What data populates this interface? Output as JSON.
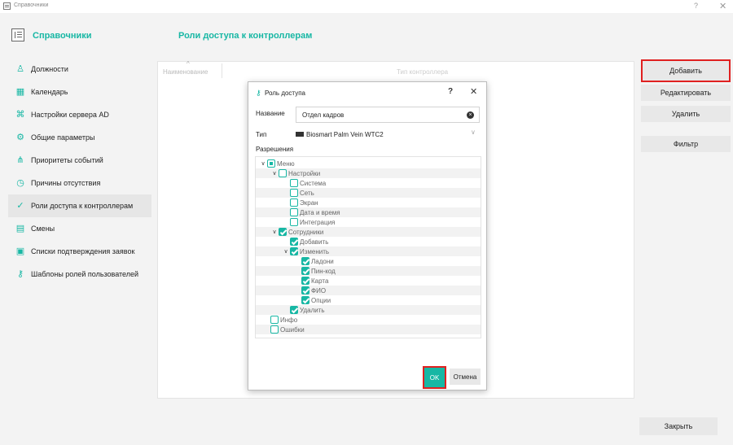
{
  "window": {
    "title": "Справочники",
    "help": "?",
    "close": "✕"
  },
  "header": {
    "title": "Справочники",
    "page_title": "Роли доступа к контроллерам"
  },
  "sidebar": {
    "items": [
      {
        "label": "Должности",
        "icon": "person-icon"
      },
      {
        "label": "Календарь",
        "icon": "calendar-icon"
      },
      {
        "label": "Настройки сервера AD",
        "icon": "network-icon"
      },
      {
        "label": "Общие параметры",
        "icon": "gear-icon"
      },
      {
        "label": "Приоритеты событий",
        "icon": "hierarchy-icon"
      },
      {
        "label": "Причины отсутствия",
        "icon": "clock-icon"
      },
      {
        "label": "Роли доступа к контроллерам",
        "icon": "shield-check-icon",
        "active": true
      },
      {
        "label": "Смены",
        "icon": "schedule-icon"
      },
      {
        "label": "Списки подтверждения заявок",
        "icon": "clipboard-icon"
      },
      {
        "label": "Шаблоны ролей пользователей",
        "icon": "key-icon"
      }
    ]
  },
  "table": {
    "columns": [
      "Наименование",
      "Тип контроллера"
    ]
  },
  "actions": {
    "add": "Добавить",
    "edit": "Редактировать",
    "delete": "Удалить",
    "filter": "Фильтр",
    "close": "Закрыть"
  },
  "dialog": {
    "title": "Роль доступа",
    "help": "?",
    "close": "✕",
    "name_label": "Название",
    "name_value": "Отдел кадров",
    "type_label": "Тип",
    "type_value": "Biosmart Palm Vein WTC2",
    "permissions_label": "Разрешения",
    "tree": [
      {
        "label": "Меню",
        "level": 0,
        "arrow": true,
        "state": "partial"
      },
      {
        "label": "Настройки",
        "level": 1,
        "arrow": true,
        "state": "unchecked"
      },
      {
        "label": "Система",
        "level": 2,
        "arrow": false,
        "state": "unchecked"
      },
      {
        "label": "Сеть",
        "level": 2,
        "arrow": false,
        "state": "unchecked"
      },
      {
        "label": "Экран",
        "level": 2,
        "arrow": false,
        "state": "unchecked"
      },
      {
        "label": "Дата и время",
        "level": 2,
        "arrow": false,
        "state": "unchecked"
      },
      {
        "label": "Интеграция",
        "level": 2,
        "arrow": false,
        "state": "unchecked"
      },
      {
        "label": "Сотрудники",
        "level": 1,
        "arrow": true,
        "state": "checked"
      },
      {
        "label": "Добавить",
        "level": 2,
        "arrow": false,
        "state": "checked"
      },
      {
        "label": "Изменить",
        "level": 2,
        "arrow": true,
        "state": "checked"
      },
      {
        "label": "Ладони",
        "level": 3,
        "arrow": false,
        "state": "checked"
      },
      {
        "label": "Пин-код",
        "level": 3,
        "arrow": false,
        "state": "checked"
      },
      {
        "label": "Карта",
        "level": 3,
        "arrow": false,
        "state": "checked"
      },
      {
        "label": "ФИО",
        "level": 3,
        "arrow": false,
        "state": "checked"
      },
      {
        "label": "Опции",
        "level": 3,
        "arrow": false,
        "state": "checked"
      },
      {
        "label": "Удалить",
        "level": 2,
        "arrow": false,
        "state": "checked"
      },
      {
        "label": "Инфо",
        "level": 1,
        "arrow": false,
        "state": "unchecked"
      },
      {
        "label": "Ошибки",
        "level": 1,
        "arrow": false,
        "state": "unchecked"
      }
    ],
    "ok": "OK",
    "cancel": "Отмена"
  },
  "colors": {
    "accent": "#17b7a4",
    "highlight": "#e02020"
  }
}
